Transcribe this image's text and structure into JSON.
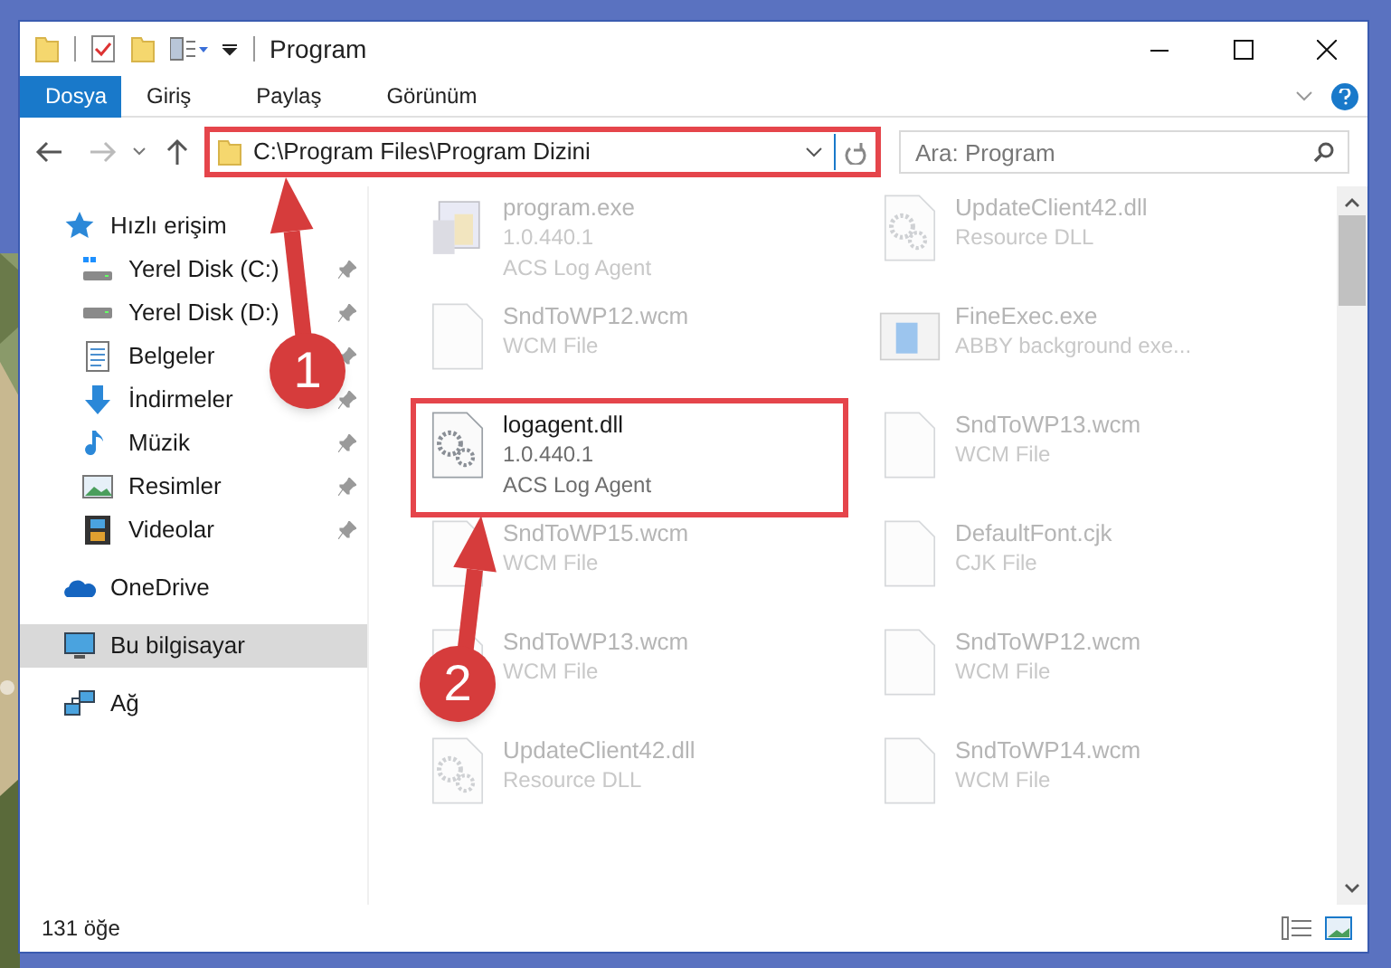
{
  "window": {
    "title": "Program"
  },
  "ribbon_tabs": [
    {
      "label": "Dosya",
      "selected": true
    },
    {
      "label": "Giriş",
      "selected": false
    },
    {
      "label": "Paylaş",
      "selected": false
    },
    {
      "label": "Görünüm",
      "selected": false
    }
  ],
  "address_bar": {
    "path": "C:\\Program Files\\Program Dizini",
    "highlighted": true
  },
  "search": {
    "placeholder": "Ara: Program"
  },
  "sidebar": {
    "items": [
      {
        "label": "Hızlı erişim",
        "kind": "star",
        "selected": false,
        "children": [
          {
            "label": "Yerel Disk (C:)",
            "kind": "drive-c",
            "pinned": true,
            "selected": false
          },
          {
            "label": "Yerel Disk (D:)",
            "kind": "drive",
            "pinned": true,
            "selected": false
          },
          {
            "label": "Belgeler",
            "kind": "docs",
            "pinned": true,
            "selected": false
          },
          {
            "label": "İndirmeler",
            "kind": "download",
            "pinned": true,
            "selected": false
          },
          {
            "label": "Müzik",
            "kind": "music",
            "pinned": true,
            "selected": false
          },
          {
            "label": "Resimler",
            "kind": "pictures",
            "pinned": true,
            "selected": false
          },
          {
            "label": "Videolar",
            "kind": "videos",
            "pinned": true,
            "selected": false
          }
        ]
      },
      {
        "label": "OneDrive",
        "kind": "cloud",
        "selected": false
      },
      {
        "label": "Bu bilgisayar",
        "kind": "computer",
        "selected": true
      },
      {
        "label": "Ağ",
        "kind": "network",
        "selected": false
      }
    ]
  },
  "files": [
    {
      "name": "program.exe",
      "details": [
        "1.0.440.1",
        "ACS Log Agent"
      ],
      "kind": "app",
      "faded": true,
      "highlighted": false
    },
    {
      "name": "UpdateClient42.dll",
      "details": [
        "Resource DLL"
      ],
      "kind": "gears",
      "faded": true,
      "highlighted": false
    },
    {
      "name": "SndToWP12.wcm",
      "details": [
        "WCM File"
      ],
      "kind": "blank",
      "faded": true,
      "highlighted": false
    },
    {
      "name": "FineExec.exe",
      "details": [
        "ABBY background exe..."
      ],
      "kind": "window",
      "faded": true,
      "highlighted": false
    },
    {
      "name": "logagent.dll",
      "details": [
        "1.0.440.1",
        "ACS Log Agent"
      ],
      "kind": "gears",
      "faded": false,
      "highlighted": true
    },
    {
      "name": "SndToWP13.wcm",
      "details": [
        "WCM File"
      ],
      "kind": "blank",
      "faded": true,
      "highlighted": false
    },
    {
      "name": "SndToWP15.wcm",
      "details": [
        "WCM File"
      ],
      "kind": "blank",
      "faded": true,
      "highlighted": false
    },
    {
      "name": "DefaultFont.cjk",
      "details": [
        "CJK File"
      ],
      "kind": "blank",
      "faded": true,
      "highlighted": false
    },
    {
      "name": "SndToWP13.wcm",
      "details": [
        "WCM File"
      ],
      "kind": "blank",
      "faded": true,
      "highlighted": false
    },
    {
      "name": "SndToWP12.wcm",
      "details": [
        "WCM File"
      ],
      "kind": "blank",
      "faded": true,
      "highlighted": false
    },
    {
      "name": "UpdateClient42.dll",
      "details": [
        "Resource DLL"
      ],
      "kind": "gears",
      "faded": true,
      "highlighted": false
    },
    {
      "name": "SndToWP14.wcm",
      "details": [
        "WCM File"
      ],
      "kind": "blank",
      "faded": true,
      "highlighted": false
    }
  ],
  "annotations": [
    {
      "label": "1"
    },
    {
      "label": "2"
    }
  ],
  "status_bar": {
    "item_count": "131 öğe"
  }
}
